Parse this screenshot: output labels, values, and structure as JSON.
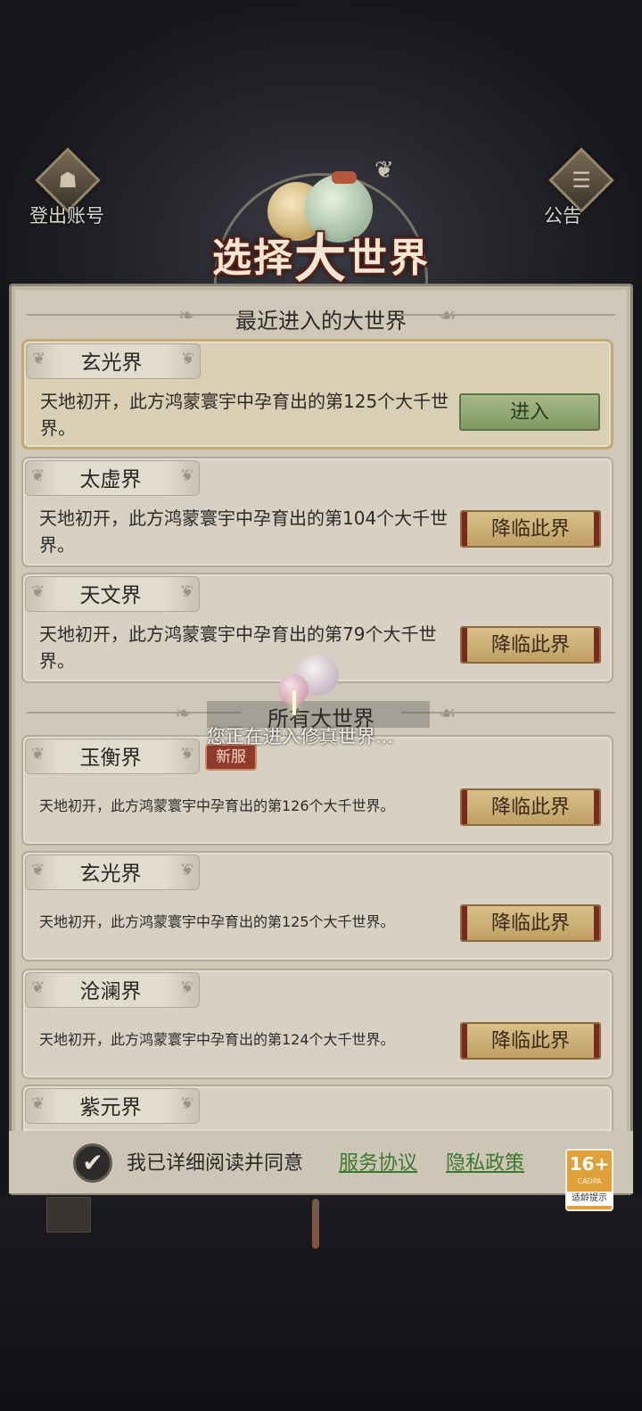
{
  "header": {
    "logout_label": "登出账号",
    "notice_label": "公告",
    "title_parts": [
      "选择",
      "大",
      "世界"
    ]
  },
  "recent": {
    "section_title": "最近进入的大世界",
    "items": [
      {
        "name": "玄光界",
        "desc": "天地初开，此方鸿蒙寰宇中孕育出的第125个大千世界。",
        "button": "进入"
      },
      {
        "name": "太虚界",
        "desc": "天地初开，此方鸿蒙寰宇中孕育出的第104个大千世界。",
        "button": "降临此界"
      },
      {
        "name": "天文界",
        "desc": "天地初开，此方鸿蒙寰宇中孕育出的第79个大千世界。",
        "button": "降临此界"
      }
    ]
  },
  "all": {
    "section_title": "所有大世界",
    "items": [
      {
        "name": "玉衡界",
        "badge": "新服",
        "desc": "天地初开，此方鸿蒙寰宇中孕育出的第126个大千世界。",
        "button": "降临此界"
      },
      {
        "name": "玄光界",
        "desc": "天地初开，此方鸿蒙寰宇中孕育出的第125个大千世界。",
        "button": "降临此界"
      },
      {
        "name": "沧澜界",
        "desc": "天地初开，此方鸿蒙寰宇中孕育出的第124个大千世界。",
        "button": "降临此界"
      },
      {
        "name": "紫元界"
      }
    ]
  },
  "loading": {
    "text": "您正在进入修真世界..."
  },
  "agreement": {
    "checked": true,
    "text": "我已详细阅读并同意",
    "terms_link": "服务协议",
    "privacy_link": "隐私政策"
  },
  "age_rating": {
    "value": "16+",
    "org": "CADPA",
    "tip": "适龄提示"
  }
}
